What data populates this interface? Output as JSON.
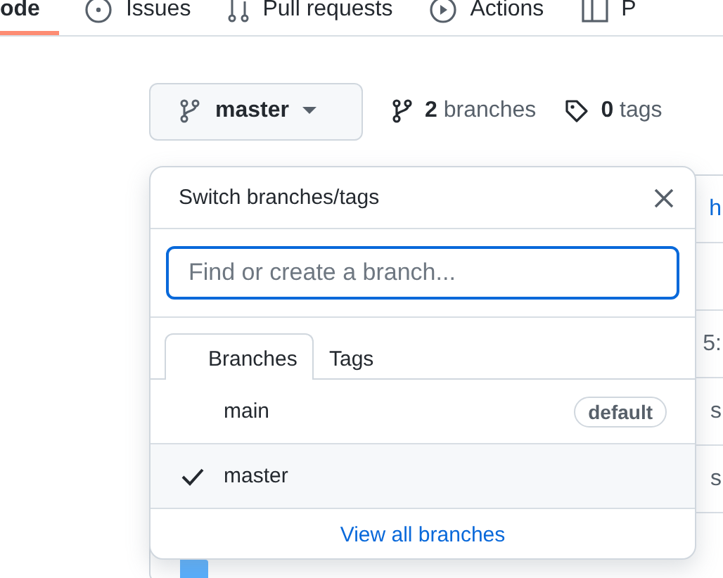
{
  "nav_tabs": [
    {
      "label": "ode",
      "selected": true
    },
    {
      "label": "Issues",
      "selected": false
    },
    {
      "label": "Pull requests",
      "selected": false
    },
    {
      "label": "Actions",
      "selected": false
    },
    {
      "label": "P",
      "selected": false
    }
  ],
  "branch_button": {
    "label": "master"
  },
  "branches_count": {
    "count": "2",
    "label": "branches"
  },
  "tags_count": {
    "count": "0",
    "label": "tags"
  },
  "background_rows": [
    {
      "kind": "link",
      "text": "h"
    },
    {
      "kind": "blank"
    },
    {
      "kind": "text",
      "text": "5:"
    },
    {
      "kind": "text",
      "text": "s"
    },
    {
      "kind": "text",
      "text": "s"
    },
    {
      "kind": "folder"
    }
  ],
  "dropdown": {
    "title": "Switch branches/tags",
    "search": {
      "placeholder": "Find or create a branch..."
    },
    "tabs": [
      {
        "label": "Branches",
        "selected": true
      },
      {
        "label": "Tags",
        "selected": false
      }
    ],
    "branches": [
      {
        "name": "main",
        "checked": false,
        "badge": "default"
      },
      {
        "name": "master",
        "checked": true
      }
    ],
    "footer_link": "View all branches"
  }
}
